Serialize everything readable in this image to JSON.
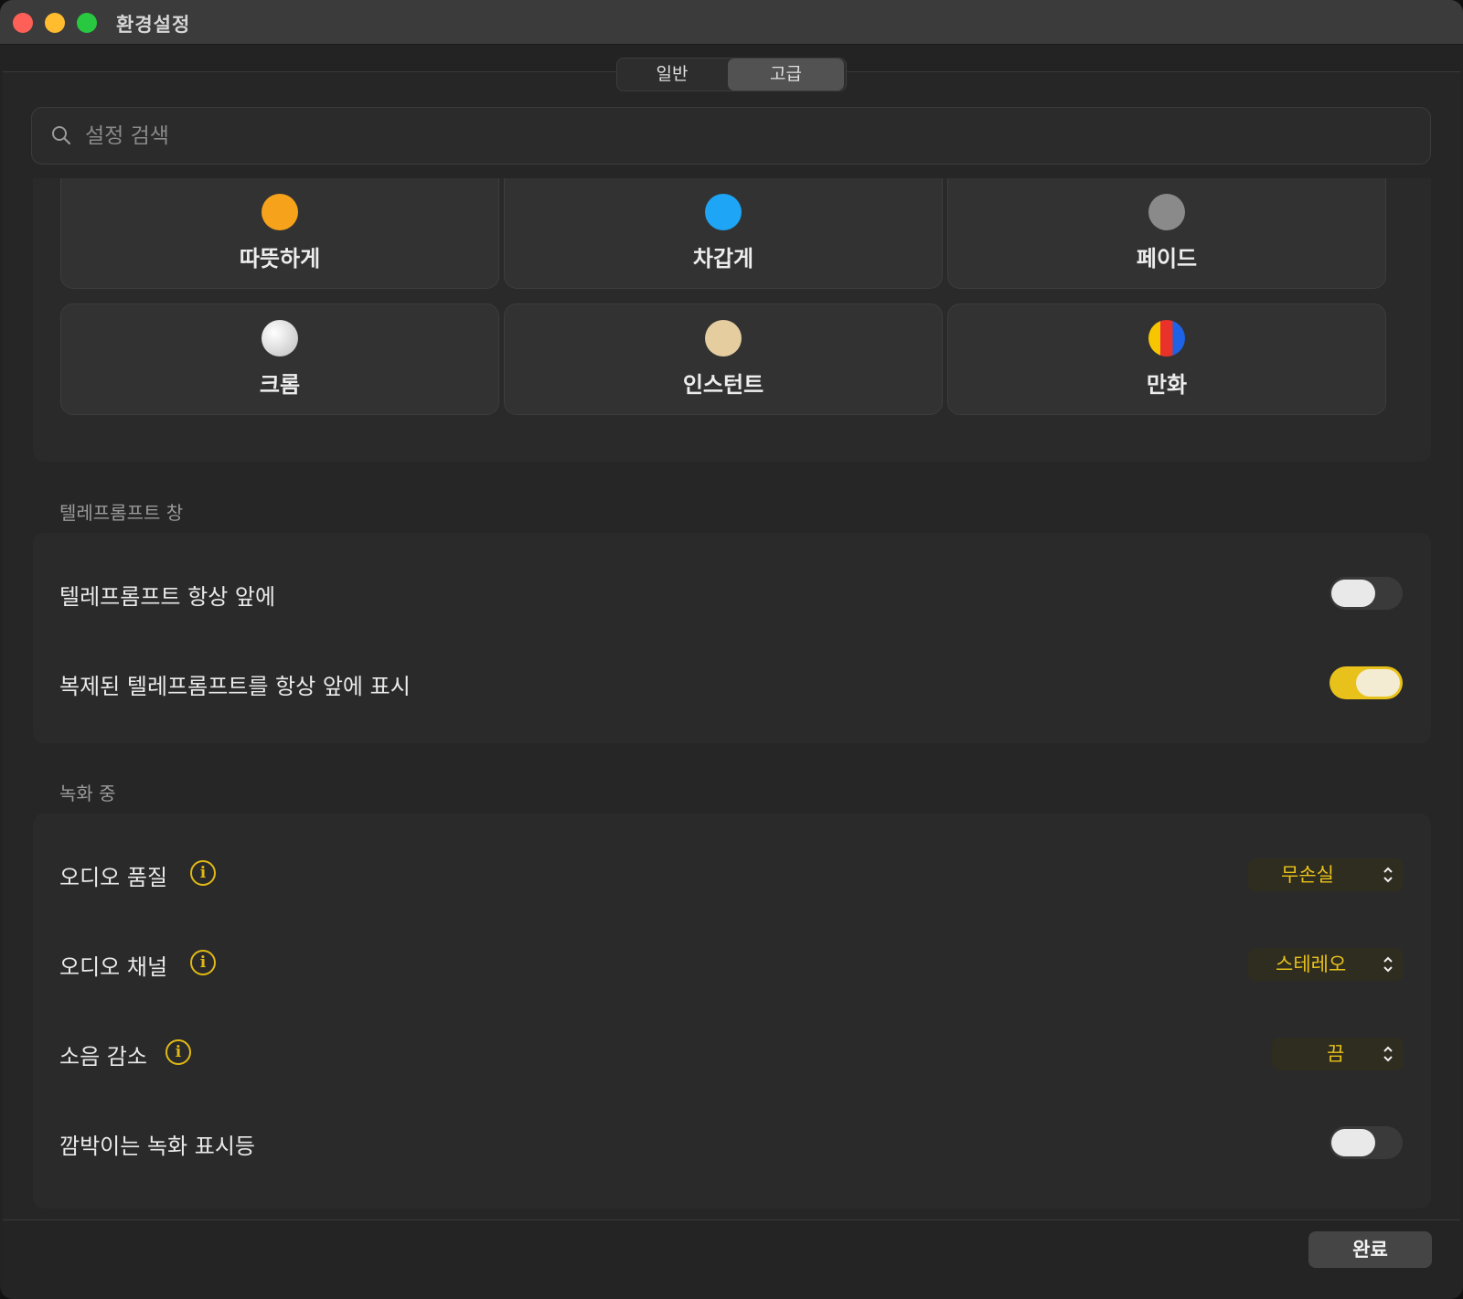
{
  "window": {
    "title": "환경설정"
  },
  "tabs": [
    {
      "label": "일반"
    },
    {
      "label": "고급",
      "selected": true
    }
  ],
  "search": {
    "placeholder": "설정 검색",
    "value": ""
  },
  "filters": [
    {
      "label": "따뜻하게",
      "color": "#f7a21b"
    },
    {
      "label": "차갑게",
      "color": "#1ea5f5"
    },
    {
      "label": "페이드",
      "color": "#8a8a8a"
    },
    {
      "label": "크롬",
      "color": "#e5e5e5"
    },
    {
      "label": "인스턴트",
      "color": "#e6cda0"
    },
    {
      "label": "만화",
      "colors": [
        "#f7c600",
        "#e8322a",
        "#1e63e6"
      ]
    }
  ],
  "teleprompter": {
    "section_title": "텔레프롬프트 창",
    "items": [
      {
        "label": "텔레프롬프트 항상 앞에",
        "enabled": false
      },
      {
        "label": "복제된 텔레프롬프트를 항상 앞에 표시",
        "enabled": true
      }
    ]
  },
  "recording": {
    "section_title": "녹화 중",
    "audio_quality": {
      "label": "오디오 품질",
      "value": "무손실"
    },
    "audio_channel": {
      "label": "오디오 채널",
      "value": "스테레오"
    },
    "noise_reduction": {
      "label": "소음 감소",
      "value": "끔"
    },
    "blinking_indicator": {
      "label": "깜박이는 녹화 표시등",
      "enabled": false
    }
  },
  "footer": {
    "done_label": "완료"
  },
  "colors": {
    "accent": "#e8c21a",
    "background": "#262626"
  }
}
